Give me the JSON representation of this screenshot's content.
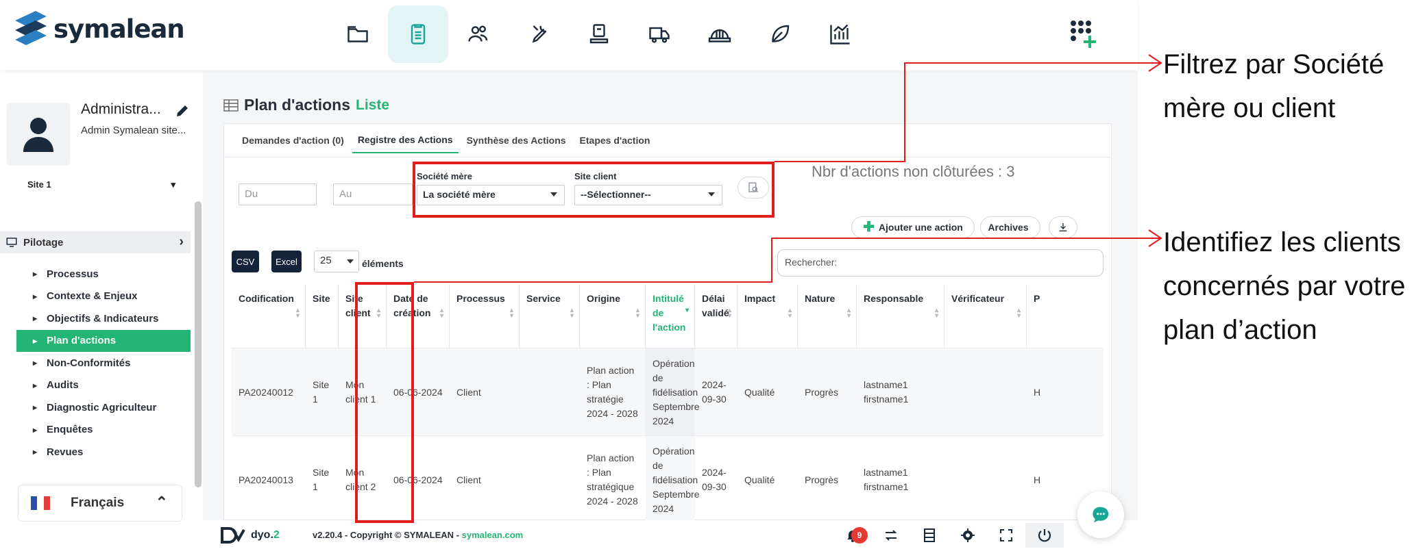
{
  "brand": {
    "name": "symalean",
    "accent": "#22b573",
    "dark": "#15233a"
  },
  "topnav": {
    "icons": [
      "folder-icon",
      "document-icon",
      "users-icon",
      "wrench-icon",
      "machine-icon",
      "truck-icon",
      "helmet-icon",
      "leaf-icon",
      "chart-icon"
    ],
    "active": "document-icon",
    "apps_icon": "apps-grid-plus-icon"
  },
  "user": {
    "name": "Administra...",
    "role": "Admin Symalean site..."
  },
  "site_select": {
    "value": "Site 1"
  },
  "sidebar": {
    "section": "Pilotage",
    "items": [
      {
        "label": "Processus"
      },
      {
        "label": "Contexte & Enjeux"
      },
      {
        "label": "Objectifs & Indicateurs"
      },
      {
        "label": "Plan d'actions",
        "active": true
      },
      {
        "label": "Non-Conformités"
      },
      {
        "label": "Audits"
      },
      {
        "label": "Diagnostic Agriculteur"
      },
      {
        "label": "Enquêtes"
      },
      {
        "label": "Revues"
      }
    ],
    "language": "Français"
  },
  "page": {
    "title": "Plan d'actions",
    "subtitle": "Liste"
  },
  "tabs": [
    {
      "label": "Demandes d'action (0)"
    },
    {
      "label": "Registre des Actions",
      "active": true
    },
    {
      "label": "Synthèse des Actions"
    },
    {
      "label": "Etapes d'action"
    }
  ],
  "filters": {
    "date_from_placeholder": "Du",
    "date_to_placeholder": "Au",
    "parent_company_label": "Société mère",
    "parent_company_value": "La société mère",
    "client_site_label": "Site client",
    "client_site_value": "--Sélectionner--"
  },
  "count_text": "Nbr d'actions non clôturées : 3",
  "actions": {
    "add": "Ajouter une action",
    "archives": "Archives"
  },
  "export": {
    "csv": "CSV",
    "excel": "Excel"
  },
  "page_size": {
    "value": "25",
    "suffix": "éléments"
  },
  "search": {
    "placeholder": "Rechercher:"
  },
  "table": {
    "headers": [
      "Codification",
      "Site",
      "Site client",
      "Date de création",
      "Processus",
      "Service",
      "Origine",
      "Intitulé de l'action",
      "Délai validé",
      "Impact",
      "Nature",
      "Responsable",
      "Vérificateur",
      "P"
    ],
    "rows": [
      {
        "code": "PA20240012",
        "site": "Site 1",
        "site_client": "Mon client 1",
        "date": "06-06-2024",
        "processus": "Client",
        "service": "",
        "origine": "Plan action : Plan stratégie 2024 - 2028",
        "intitule": "Opération de fidélisation Septembre 2024",
        "delai": "2024-09-30",
        "impact": "Qualité",
        "nature": "Progrès",
        "responsable": "lastname1 firstname1",
        "verificateur": "",
        "extra": "H"
      },
      {
        "code": "PA20240013",
        "site": "Site 1",
        "site_client": "Mon client 2",
        "date": "06-06-2024",
        "processus": "Client",
        "service": "",
        "origine": "Plan action : Plan stratégique 2024 - 2028",
        "intitule": "Opération de fidélisation Septembre 2024",
        "delai": "2024-09-30",
        "impact": "Qualité",
        "nature": "Progrès",
        "responsable": "lastname1 firstname1",
        "verificateur": "",
        "extra": "H"
      }
    ]
  },
  "footer": {
    "logo": "dyo.",
    "logo_version": "2",
    "copyright": "v2.20.4 - Copyright © SYMALEAN - ",
    "link": "symalean.com",
    "notifications": "9"
  },
  "annotations": {
    "filter_note": "Filtrez par Société mère ou client",
    "client_note": "Identifiez les clients concernés par votre plan d’action",
    "color": "#e21c1c"
  }
}
